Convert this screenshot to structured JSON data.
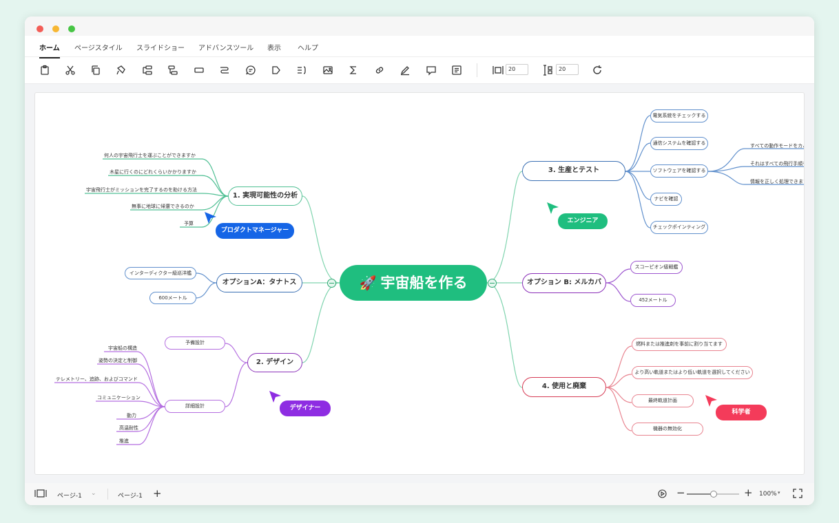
{
  "menu": {
    "items": [
      "ホーム",
      "ページスタイル",
      "スライドショー",
      "アドバンスツール",
      "表示",
      "ヘルプ"
    ]
  },
  "toolbar": {
    "width_value": "20",
    "height_value": "20"
  },
  "mindmap": {
    "center": "宇宙船を作る",
    "n1": {
      "title": "1. 実現可能性の分析",
      "leaves": [
        "何人の宇宙飛行士を運ぶことができますか",
        "木星に行くのにどれくらいかかりますか",
        "宇宙飛行士がミッションを完了するのを助ける方法",
        "無事に地球に帰還できるのか",
        "予算"
      ]
    },
    "nA": {
      "title": "オプションA：タナトス",
      "leaves": [
        "インターディクター級巡洋艦",
        "600メートル"
      ]
    },
    "n2": {
      "title": "2. デザイン",
      "sub1": "予備設計",
      "sub2": "詳細設計",
      "leaves": [
        "宇宙船の構造",
        "姿勢の決定と制御",
        "テレメトリー、追跡、およびコマンド",
        "コミュニケーション",
        "動力",
        "高温耐性",
        "推進"
      ]
    },
    "n3": {
      "title": "3. 生産とテスト",
      "leaves": [
        "電気系統をチェックする",
        "通信システムを確認する",
        "ソフトウェアを確認する",
        "ナビを確認",
        "チェックポインティング"
      ],
      "subleaves": [
        "すべての動作モードをカバ",
        "それはすべての飛行手順を",
        "情報を正しく処理できます"
      ]
    },
    "nB": {
      "title": "オプション B: メルカバ",
      "leaves": [
        "スコーピオン級戦艦",
        "452メートル"
      ]
    },
    "n4": {
      "title": "4. 使用と廃棄",
      "leaves": [
        "燃料または推進剤を事前に割り当てます",
        "より高い軌道またはより低い軌道を選択してください",
        "最終軌道計画",
        "機器の無効化"
      ]
    },
    "tags": {
      "pm": "プロダクトマネージャー",
      "engineer": "エンジニア",
      "designer": "デザイナー",
      "scientist": "科学者"
    }
  },
  "colors": {
    "green": "#1fbe7f",
    "blue": "#3a6fb3",
    "purple": "#8a2fb8",
    "red": "#d63b54",
    "pm_tag": "#1565e6",
    "designer_tag": "#8e2de2",
    "scientist_tag": "#f43b5a"
  },
  "statusbar": {
    "page_select": "ページ-1",
    "page_tab": "ページ-1",
    "zoom": "100%",
    "zoom_level": 0.5
  }
}
